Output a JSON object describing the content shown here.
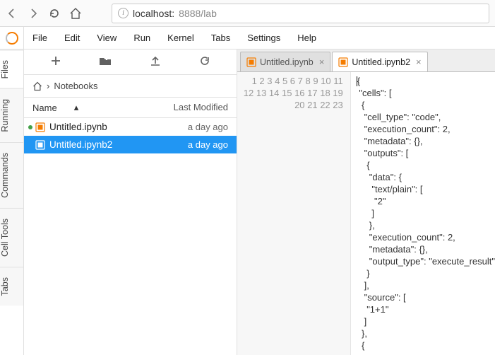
{
  "browser": {
    "url_host": "localhost:",
    "url_port_path": "8888/lab"
  },
  "menu": {
    "items": [
      "File",
      "Edit",
      "View",
      "Run",
      "Kernel",
      "Tabs",
      "Settings",
      "Help"
    ]
  },
  "side_tabs": [
    "Files",
    "Running",
    "Commands",
    "Cell Tools",
    "Tabs"
  ],
  "filebrowser": {
    "crumb_label": "Notebooks",
    "col_name": "Name",
    "col_mod": "Last Modified",
    "items": [
      {
        "name": "Untitled.ipynb",
        "modified": "a day ago",
        "running": true,
        "selected": false
      },
      {
        "name": "Untitled.ipynb2",
        "modified": "a day ago",
        "running": false,
        "selected": true
      }
    ]
  },
  "doc_tabs": [
    {
      "label": "Untitled.ipynb",
      "active": false
    },
    {
      "label": "Untitled.ipynb2",
      "active": true
    }
  ],
  "editor_lines": [
    "{",
    " \"cells\": [",
    "  {",
    "   \"cell_type\": \"code\",",
    "   \"execution_count\": 2,",
    "   \"metadata\": {},",
    "   \"outputs\": [",
    "    {",
    "     \"data\": {",
    "      \"text/plain\": [",
    "       \"2\"",
    "      ]",
    "     },",
    "     \"execution_count\": 2,",
    "     \"metadata\": {},",
    "     \"output_type\": \"execute_result\"",
    "    }",
    "   ],",
    "   \"source\": [",
    "    \"1+1\"",
    "   ]",
    "  },",
    "  {"
  ]
}
